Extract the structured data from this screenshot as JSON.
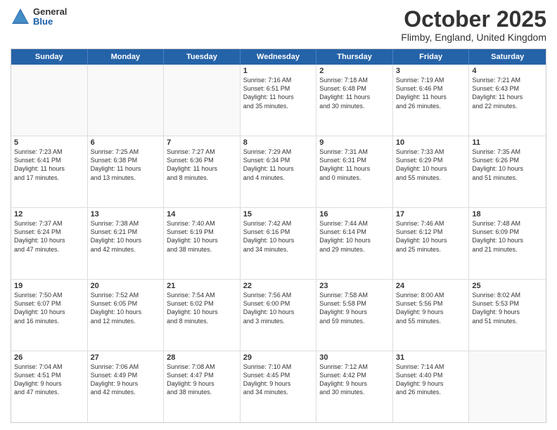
{
  "logo": {
    "general": "General",
    "blue": "Blue"
  },
  "title": "October 2025",
  "location": "Flimby, England, United Kingdom",
  "days_of_week": [
    "Sunday",
    "Monday",
    "Tuesday",
    "Wednesday",
    "Thursday",
    "Friday",
    "Saturday"
  ],
  "weeks": [
    [
      {
        "day": "",
        "info": ""
      },
      {
        "day": "",
        "info": ""
      },
      {
        "day": "",
        "info": ""
      },
      {
        "day": "1",
        "info": "Sunrise: 7:16 AM\nSunset: 6:51 PM\nDaylight: 11 hours\nand 35 minutes."
      },
      {
        "day": "2",
        "info": "Sunrise: 7:18 AM\nSunset: 6:48 PM\nDaylight: 11 hours\nand 30 minutes."
      },
      {
        "day": "3",
        "info": "Sunrise: 7:19 AM\nSunset: 6:46 PM\nDaylight: 11 hours\nand 26 minutes."
      },
      {
        "day": "4",
        "info": "Sunrise: 7:21 AM\nSunset: 6:43 PM\nDaylight: 11 hours\nand 22 minutes."
      }
    ],
    [
      {
        "day": "5",
        "info": "Sunrise: 7:23 AM\nSunset: 6:41 PM\nDaylight: 11 hours\nand 17 minutes."
      },
      {
        "day": "6",
        "info": "Sunrise: 7:25 AM\nSunset: 6:38 PM\nDaylight: 11 hours\nand 13 minutes."
      },
      {
        "day": "7",
        "info": "Sunrise: 7:27 AM\nSunset: 6:36 PM\nDaylight: 11 hours\nand 8 minutes."
      },
      {
        "day": "8",
        "info": "Sunrise: 7:29 AM\nSunset: 6:34 PM\nDaylight: 11 hours\nand 4 minutes."
      },
      {
        "day": "9",
        "info": "Sunrise: 7:31 AM\nSunset: 6:31 PM\nDaylight: 11 hours\nand 0 minutes."
      },
      {
        "day": "10",
        "info": "Sunrise: 7:33 AM\nSunset: 6:29 PM\nDaylight: 10 hours\nand 55 minutes."
      },
      {
        "day": "11",
        "info": "Sunrise: 7:35 AM\nSunset: 6:26 PM\nDaylight: 10 hours\nand 51 minutes."
      }
    ],
    [
      {
        "day": "12",
        "info": "Sunrise: 7:37 AM\nSunset: 6:24 PM\nDaylight: 10 hours\nand 47 minutes."
      },
      {
        "day": "13",
        "info": "Sunrise: 7:38 AM\nSunset: 6:21 PM\nDaylight: 10 hours\nand 42 minutes."
      },
      {
        "day": "14",
        "info": "Sunrise: 7:40 AM\nSunset: 6:19 PM\nDaylight: 10 hours\nand 38 minutes."
      },
      {
        "day": "15",
        "info": "Sunrise: 7:42 AM\nSunset: 6:16 PM\nDaylight: 10 hours\nand 34 minutes."
      },
      {
        "day": "16",
        "info": "Sunrise: 7:44 AM\nSunset: 6:14 PM\nDaylight: 10 hours\nand 29 minutes."
      },
      {
        "day": "17",
        "info": "Sunrise: 7:46 AM\nSunset: 6:12 PM\nDaylight: 10 hours\nand 25 minutes."
      },
      {
        "day": "18",
        "info": "Sunrise: 7:48 AM\nSunset: 6:09 PM\nDaylight: 10 hours\nand 21 minutes."
      }
    ],
    [
      {
        "day": "19",
        "info": "Sunrise: 7:50 AM\nSunset: 6:07 PM\nDaylight: 10 hours\nand 16 minutes."
      },
      {
        "day": "20",
        "info": "Sunrise: 7:52 AM\nSunset: 6:05 PM\nDaylight: 10 hours\nand 12 minutes."
      },
      {
        "day": "21",
        "info": "Sunrise: 7:54 AM\nSunset: 6:02 PM\nDaylight: 10 hours\nand 8 minutes."
      },
      {
        "day": "22",
        "info": "Sunrise: 7:56 AM\nSunset: 6:00 PM\nDaylight: 10 hours\nand 3 minutes."
      },
      {
        "day": "23",
        "info": "Sunrise: 7:58 AM\nSunset: 5:58 PM\nDaylight: 9 hours\nand 59 minutes."
      },
      {
        "day": "24",
        "info": "Sunrise: 8:00 AM\nSunset: 5:56 PM\nDaylight: 9 hours\nand 55 minutes."
      },
      {
        "day": "25",
        "info": "Sunrise: 8:02 AM\nSunset: 5:53 PM\nDaylight: 9 hours\nand 51 minutes."
      }
    ],
    [
      {
        "day": "26",
        "info": "Sunrise: 7:04 AM\nSunset: 4:51 PM\nDaylight: 9 hours\nand 47 minutes."
      },
      {
        "day": "27",
        "info": "Sunrise: 7:06 AM\nSunset: 4:49 PM\nDaylight: 9 hours\nand 42 minutes."
      },
      {
        "day": "28",
        "info": "Sunrise: 7:08 AM\nSunset: 4:47 PM\nDaylight: 9 hours\nand 38 minutes."
      },
      {
        "day": "29",
        "info": "Sunrise: 7:10 AM\nSunset: 4:45 PM\nDaylight: 9 hours\nand 34 minutes."
      },
      {
        "day": "30",
        "info": "Sunrise: 7:12 AM\nSunset: 4:42 PM\nDaylight: 9 hours\nand 30 minutes."
      },
      {
        "day": "31",
        "info": "Sunrise: 7:14 AM\nSunset: 4:40 PM\nDaylight: 9 hours\nand 26 minutes."
      },
      {
        "day": "",
        "info": ""
      }
    ]
  ]
}
